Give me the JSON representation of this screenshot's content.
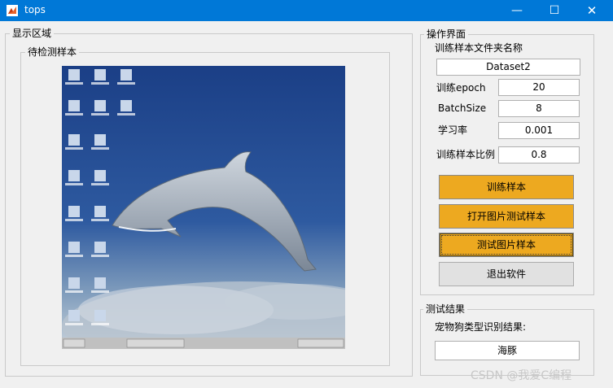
{
  "window": {
    "title": "tops",
    "min_glyph": "—",
    "max_glyph": "☐",
    "close_glyph": "✕"
  },
  "display_area": {
    "title": "显示区域",
    "sample_panel_title": "待检测样本"
  },
  "operation": {
    "title": "操作界面",
    "folder_label": "训练样本文件夹名称",
    "folder_value": "Dataset2",
    "epoch_label": "训练epoch",
    "epoch_value": "20",
    "batch_label": "BatchSize",
    "batch_value": "8",
    "lr_label": "学习率",
    "lr_value": "0.001",
    "ratio_label": "训练样本比例",
    "ratio_value": "0.8",
    "train_button": "训练样本",
    "open_button": "打开图片测试样本",
    "test_button": "测试图片样本",
    "exit_button": "退出软件"
  },
  "result": {
    "title": "测试结果",
    "label": "宠物狗类型识别结果:",
    "value": "海豚"
  },
  "watermark": "CSDN @我爱C编程",
  "colors": {
    "titlebar": "#0078d7",
    "button_orange": "#eda920",
    "button_gray": "#e1e1e1",
    "window_bg": "#f0f0f0"
  }
}
